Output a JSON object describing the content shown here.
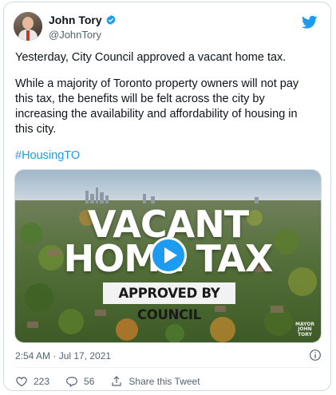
{
  "user": {
    "name": "John Tory",
    "handle": "@JohnTory"
  },
  "tweet": {
    "line1": "Yesterday, City Council approved a vacant home tax.",
    "line2": "While a majority of Toronto property owners will not pay this tax, the benefits will be felt across the city by increasing the availability and affordability of housing in this city.",
    "hashtag": "#HousingTO"
  },
  "media": {
    "title_line1": "VACANT",
    "title_line2": "HOME TAX",
    "banner": "APPROVED BY COUNCIL",
    "watermark": "MAYOR JOHN TORY"
  },
  "meta": {
    "timestamp": "2:54 AM · Jul 17, 2021"
  },
  "actions": {
    "likes": "223",
    "replies": "56",
    "share": "Share this Tweet"
  },
  "colors": {
    "accent": "#1d9bf0",
    "text": "#0f1419",
    "muted": "#536471"
  }
}
